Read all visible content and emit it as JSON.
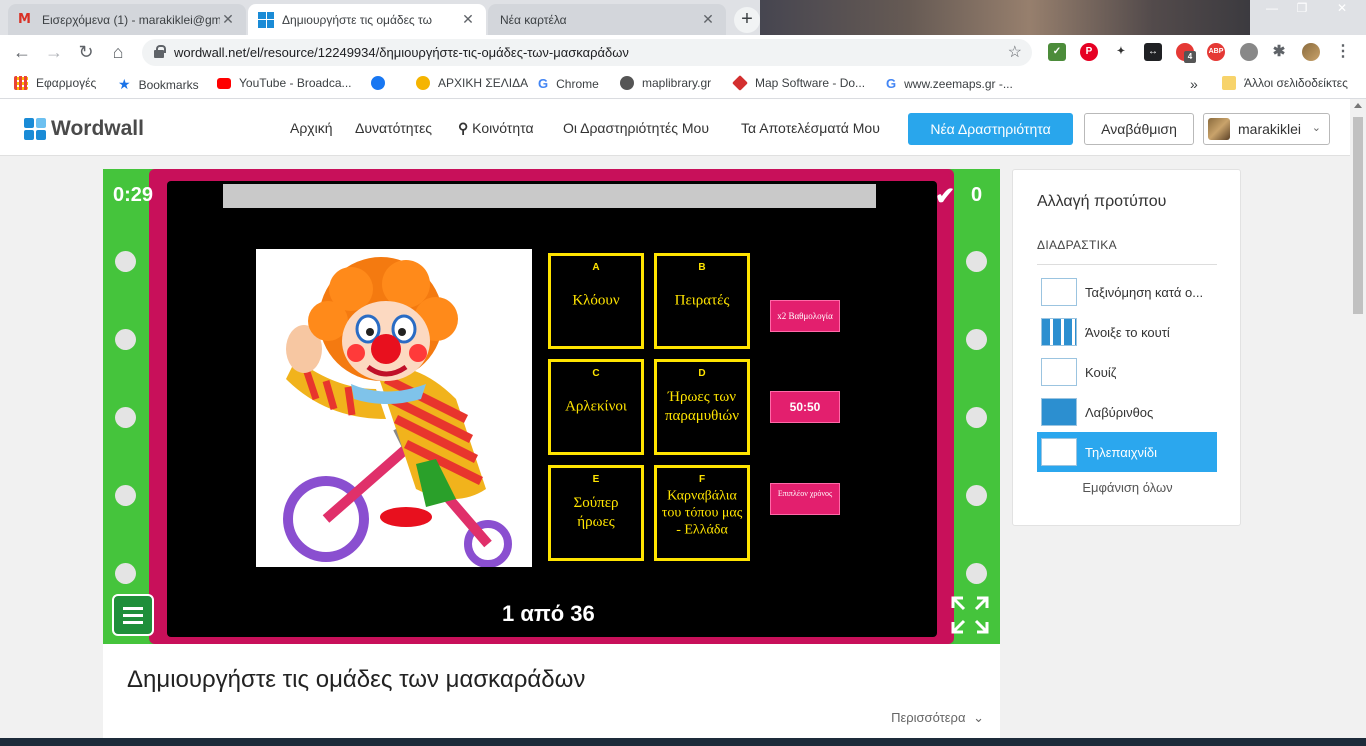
{
  "browser": {
    "tabs": [
      {
        "title": "Εισερχόμενα (1) - marakiklei@gm",
        "favicon": "gmail-icon",
        "active": false
      },
      {
        "title": "Δημιουργήστε τις ομάδες τω",
        "favicon": "wordwall-icon",
        "active": true
      },
      {
        "title": "Νέα καρτέλα",
        "favicon": "",
        "active": false
      }
    ],
    "new_tab": "+",
    "url": "wordwall.net/el/resource/12249934/δημιουργήστε-τις-ομάδες-των-μασκαράδων",
    "extension_badge": "4",
    "bookmarks": [
      {
        "label": "Εφαρμογές",
        "icon": "apps-grid-icon",
        "color": "#e94335"
      },
      {
        "label": "Bookmarks",
        "icon": "star-icon",
        "color": "#1a73e8"
      },
      {
        "label": "YouTube - Broadca...",
        "icon": "youtube-icon",
        "color": "#ff0000"
      },
      {
        "label": "",
        "icon": "facebook-icon",
        "color": "#1877f2"
      },
      {
        "label": "ΑΡΧΙΚΗ ΣΕΛΙΔΑ",
        "icon": "smiley-icon",
        "color": "#f5b400"
      },
      {
        "label": "Chrome",
        "icon": "google-g-icon",
        "color": "#4285f4"
      },
      {
        "label": "maplibrary.gr",
        "icon": "globe-icon",
        "color": "#444444"
      },
      {
        "label": "Map Software - Do...",
        "icon": "map-diamond-icon",
        "color": "#d32f2f"
      },
      {
        "label": "www.zeemaps.gr -...",
        "icon": "google-g-icon",
        "color": "#4285f4"
      }
    ],
    "bookmarks_more": "»",
    "other_bookmarks": "Άλλοι σελιδοδείκτες"
  },
  "site": {
    "logo": "Wordwall",
    "nav": [
      "Αρχική",
      "Δυνατότητες",
      "Κοινότητα",
      "Οι Δραστηριότητές Μου",
      "Τα Αποτελέσματά Μου"
    ],
    "new_activity": "Νέα Δραστηριότητα",
    "upgrade": "Αναβάθμιση",
    "user": "marakiklei"
  },
  "game": {
    "timer": "0:29",
    "score": "0",
    "time_remaining_fraction": 1.0,
    "counter": "1 από 36",
    "answers": [
      {
        "letter": "A",
        "text": "Κλόουν"
      },
      {
        "letter": "B",
        "text": "Πειρατές"
      },
      {
        "letter": "C",
        "text": "Αρλεκίνοι"
      },
      {
        "letter": "D",
        "text": "Ήρωες των παραμυθιών"
      },
      {
        "letter": "E",
        "text": "Σούπερ ήρωες"
      },
      {
        "letter": "F",
        "text": "Καρναβάλια του τόπου μας - Ελλάδα"
      }
    ],
    "powerups": [
      {
        "label": "x2 Βαθμολογία"
      },
      {
        "label": "50:50"
      },
      {
        "label": "Επιπλέον χρόνος"
      }
    ],
    "colors": {
      "rail": "#45c43c",
      "curtain": "#c8105a",
      "card_border": "#ffe400",
      "powerup": "#e31f6e"
    }
  },
  "activity": {
    "title": "Δημιουργήστε τις ομάδες των μασκαράδων",
    "more": "Περισσότερα"
  },
  "templates_panel": {
    "heading": "Αλλαγή προτύπου",
    "section": "ΔΙΑΔΡΑΣΤΙΚΑ",
    "items": [
      {
        "label": "Ταξινόμηση κατά ο...",
        "selected": false
      },
      {
        "label": "Άνοιξε το κουτί",
        "selected": false
      },
      {
        "label": "Κουίζ",
        "selected": false
      },
      {
        "label": "Λαβύρινθος",
        "selected": false
      },
      {
        "label": "Τηλεπαιχνίδι",
        "selected": true
      }
    ],
    "show_all": "Εμφάνιση όλων"
  }
}
